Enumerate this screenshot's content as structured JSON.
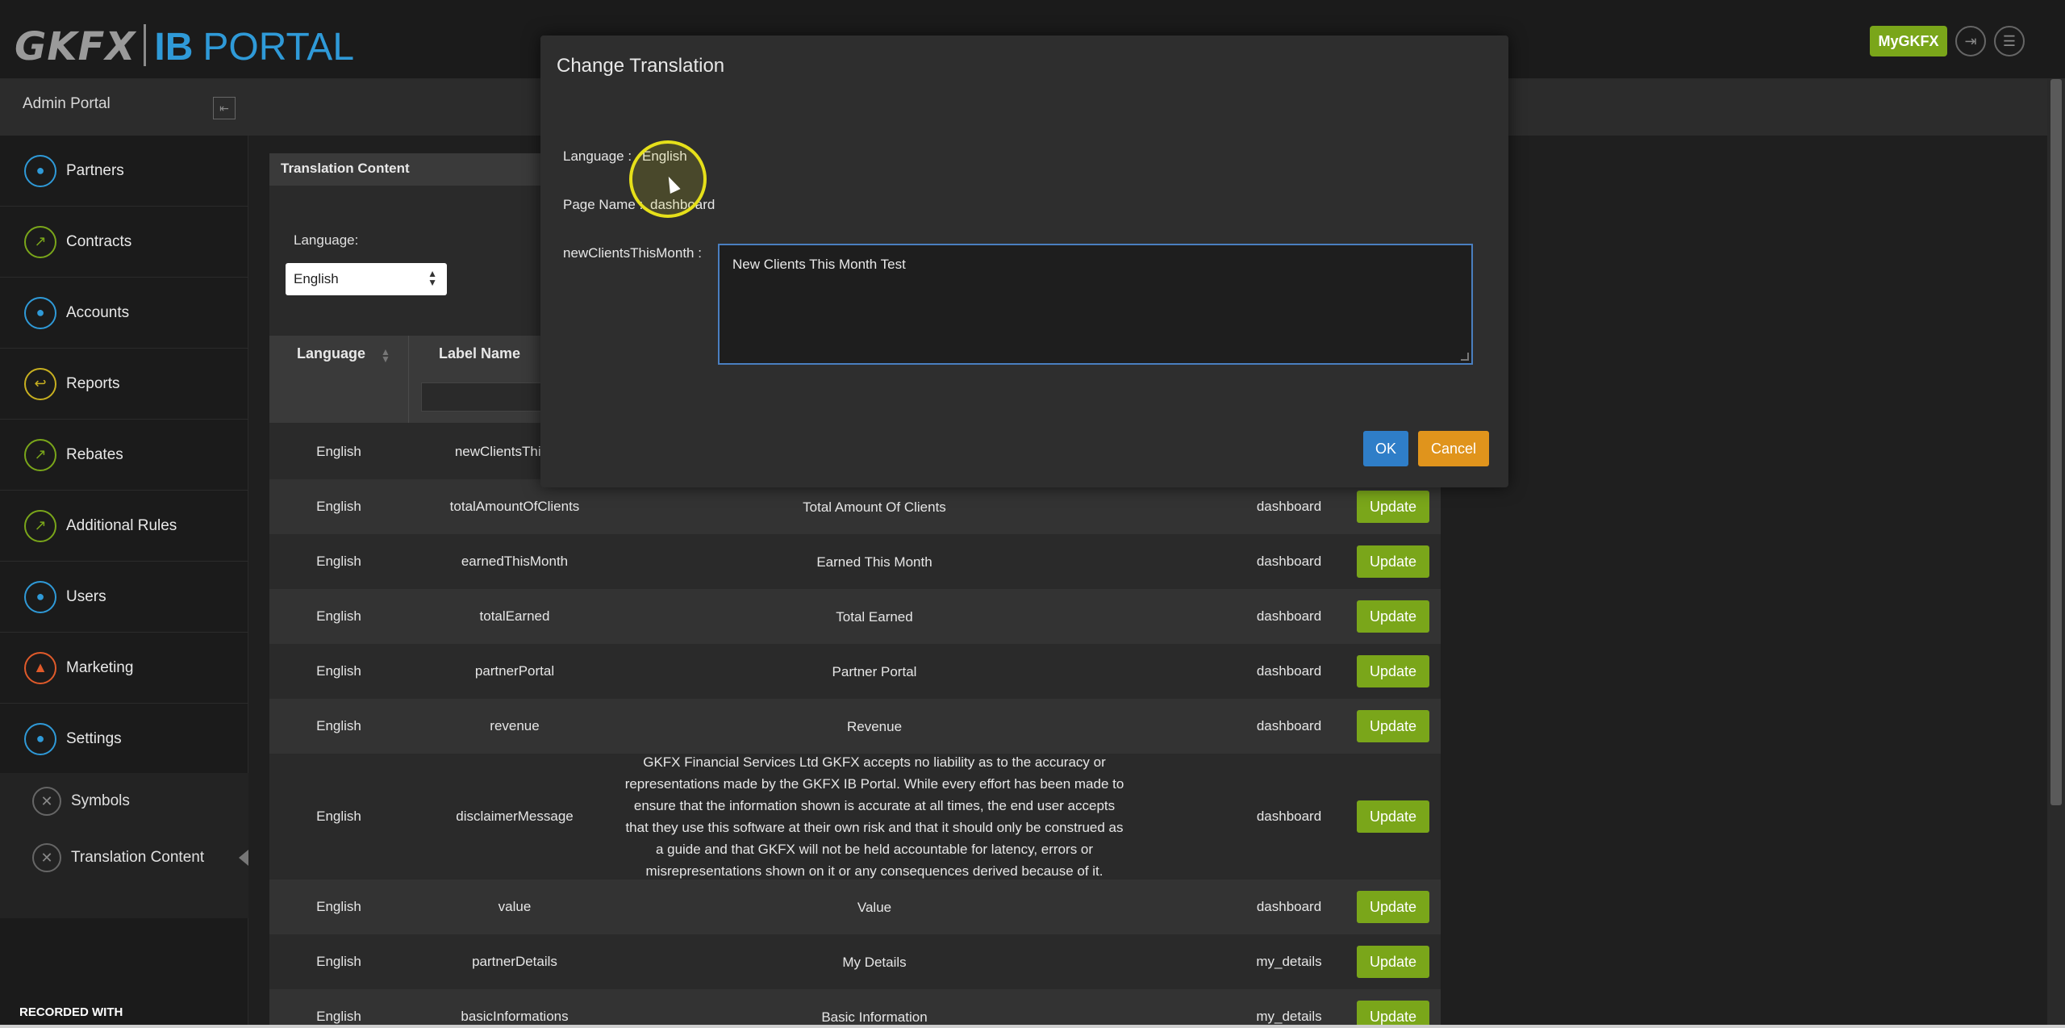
{
  "header": {
    "logo_gkfx": "GKFX",
    "logo_ib": "IB",
    "logo_portal": "PORTAL",
    "mygkfx_label": "MyGKFX"
  },
  "sidebar": {
    "title": "Admin Portal",
    "items": [
      {
        "label": "Partners",
        "icon": "user-icon",
        "color": "#2f9ad8"
      },
      {
        "label": "Contracts",
        "icon": "chart-icon",
        "color": "#7aa61a"
      },
      {
        "label": "Accounts",
        "icon": "user-icon",
        "color": "#2f9ad8"
      },
      {
        "label": "Reports",
        "icon": "reply-icon",
        "color": "#c8b020"
      },
      {
        "label": "Rebates",
        "icon": "chart-icon",
        "color": "#7aa61a"
      },
      {
        "label": "Additional Rules",
        "icon": "chart-icon",
        "color": "#7aa61a"
      },
      {
        "label": "Users",
        "icon": "user-icon",
        "color": "#2f9ad8"
      },
      {
        "label": "Marketing",
        "icon": "bell-icon",
        "color": "#e05a2a"
      },
      {
        "label": "Settings",
        "icon": "user-icon",
        "color": "#2f9ad8"
      }
    ],
    "sub_items": [
      {
        "label": "Symbols",
        "icon": "wrench-icon"
      },
      {
        "label": "Translation Content",
        "icon": "wrench-icon"
      }
    ]
  },
  "content": {
    "panel_title": "Translation Content",
    "language_label": "Language:",
    "language_selected": "English",
    "columns": [
      "Language",
      "Label Name"
    ],
    "rows": [
      {
        "language": "English",
        "label": "newClientsThisMon",
        "value": "",
        "page": ""
      },
      {
        "language": "English",
        "label": "totalAmountOfClients",
        "value": "Total Amount Of Clients",
        "page": "dashboard"
      },
      {
        "language": "English",
        "label": "earnedThisMonth",
        "value": "Earned This Month",
        "page": "dashboard"
      },
      {
        "language": "English",
        "label": "totalEarned",
        "value": "Total Earned",
        "page": "dashboard"
      },
      {
        "language": "English",
        "label": "partnerPortal",
        "value": "Partner Portal",
        "page": "dashboard"
      },
      {
        "language": "English",
        "label": "revenue",
        "value": "Revenue",
        "page": "dashboard"
      },
      {
        "language": "English",
        "label": "disclaimerMessage",
        "value": "GKFX Financial Services Ltd GKFX accepts no liability as to the accuracy or representations made by the GKFX IB Portal. While every effort has been made to ensure that the information shown is accurate at all times, the end user accepts that they use this software at their own risk and that it should only be construed as a guide and that GKFX will not be held accountable for latency, errors or misrepresentations shown on it or any consequences derived because of it.",
        "page": "dashboard"
      },
      {
        "language": "English",
        "label": "value",
        "value": "Value",
        "page": "dashboard"
      },
      {
        "language": "English",
        "label": "partnerDetails",
        "value": "My Details",
        "page": "my_details"
      },
      {
        "language": "English",
        "label": "basicInformations",
        "value": "Basic Information",
        "page": "my_details"
      }
    ],
    "update_label": "Update"
  },
  "modal": {
    "title": "Change Translation",
    "language_label": "Language :",
    "language_value": "English",
    "page_label": "Page Name :",
    "page_value": "dashboard",
    "field_label": "newClientsThisMonth :",
    "field_value": "New Clients This Month Test",
    "ok_label": "OK",
    "cancel_label": "Cancel"
  },
  "watermark": "RECORDED WITH"
}
